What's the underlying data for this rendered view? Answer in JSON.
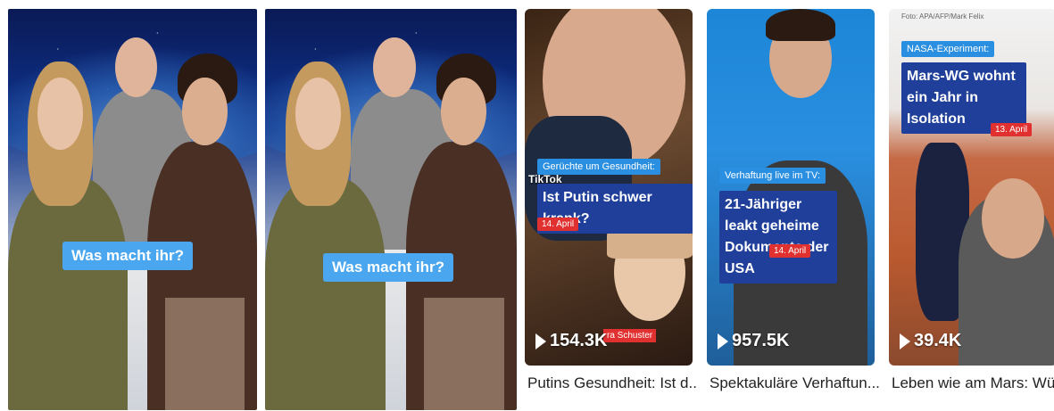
{
  "videos": [
    {
      "caption": "Was macht ihr?"
    },
    {
      "caption": "Was macht ihr?"
    }
  ],
  "cards": [
    {
      "header": "Gerüchte um Gesundheit:",
      "headline": "Ist Putin schwer krank?",
      "date": "14. April",
      "watermark": "TikTok",
      "name_tag": "ra Schuster",
      "views": "154.3K",
      "title": "Putins Gesundheit: Ist d..."
    },
    {
      "header": "Verhaftung live im TV:",
      "headline": "21-Jähriger leakt geheime Dokumente der USA",
      "date": "14. April",
      "views": "957.5K",
      "title": "Spektakuläre Verhaftun..."
    },
    {
      "credit": "Foto: APA/AFP/Mark Felix",
      "header": "NASA-Experiment:",
      "headline": "Mars-WG wohnt ein Jahr in Isolation",
      "date": "13. April",
      "views": "39.4K",
      "title": "Leben wie am Mars: Wü..."
    }
  ],
  "colors": {
    "caption_blue": "#4aa6ee",
    "headline_blue": "#1f3f9a",
    "date_red": "#e03030"
  }
}
